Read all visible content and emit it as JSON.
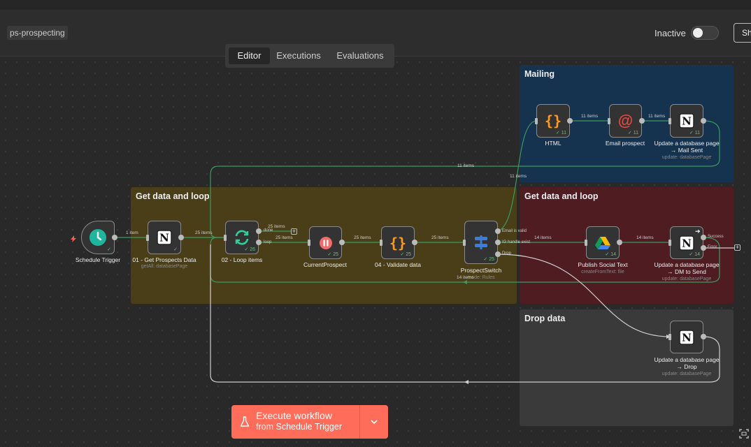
{
  "header": {
    "workflow_name": "ps-prospecting",
    "status_label": "Inactive",
    "share_label": "Sh"
  },
  "tabs": [
    {
      "label": "Editor",
      "active": true
    },
    {
      "label": "Executions",
      "active": false
    },
    {
      "label": "Evaluations",
      "active": false
    }
  ],
  "stickies": {
    "mailing": {
      "title": "Mailing",
      "color": "#15324f"
    },
    "get_data_loop": {
      "title": "Get data and loop",
      "color": "#4a3e18"
    },
    "get_data_loop_2": {
      "title": "Get data and loop",
      "color": "#4e1c21"
    },
    "drop_data": {
      "title": "Drop data",
      "color": "#3a3a3a"
    }
  },
  "nodes": {
    "schedule": {
      "label": "Schedule Trigger",
      "icon": "clock-icon"
    },
    "get_prospects": {
      "label": "01 - Get Prospects Data",
      "sub": "getAll: databasePage",
      "icon": "notion-icon"
    },
    "loop": {
      "label": "02 - Loop items",
      "count": "26",
      "icon": "loop-icon"
    },
    "current_prospect": {
      "label": "CurrentProspect",
      "count": "25",
      "icon": "pause-icon"
    },
    "validate": {
      "label": "04 - Validate data",
      "count": "25",
      "icon": "code-braces-icon"
    },
    "prospect_switch": {
      "label": "ProspectSwitch",
      "sub": "mode: Rules",
      "count": "25",
      "icon": "switch-icon"
    },
    "html": {
      "label": "HTML",
      "count": "11",
      "icon": "code-braces-icon"
    },
    "email": {
      "label": "Email prospect",
      "count": "11",
      "icon": "at-icon"
    },
    "update_mail": {
      "label1": "Update a database page",
      "label2": "→ Mail Sent",
      "sub": "update: databasePage",
      "count": "11",
      "icon": "notion-icon"
    },
    "publish": {
      "label": "Publish Social Text",
      "sub": "createFromText: file",
      "count": "14",
      "icon": "drive-icon"
    },
    "update_dm": {
      "label1": "Update a database page",
      "label2": "→ DM to Send",
      "sub": "update: databasePage",
      "count": "14",
      "icon": "notion-icon"
    },
    "update_drop": {
      "label1": "Update a database page",
      "label2": "→ Drop",
      "sub": "update: databasePage",
      "icon": "notion-icon"
    }
  },
  "edges": {
    "e1": "1 item",
    "e2": "25 items",
    "e_done": "25 items",
    "e_loop": "25 items",
    "e3": "25 items",
    "e4": "25 items",
    "e_11top": "11 items",
    "e_11right": "11 items",
    "e_html_email": "11 items",
    "e_email_update": "11 items",
    "e_ig": "14 items",
    "e_publish": "14 items",
    "e_14back": "14 items"
  },
  "outputs": {
    "done": "done",
    "loop": "loop",
    "email_valid": "Email is valid",
    "ig_handle": "IG handle exist",
    "drop": "Drop",
    "success": "Success",
    "error": "Error"
  },
  "execute": {
    "title": "Execute workflow",
    "from_label": "from",
    "from_node": "Schedule Trigger"
  },
  "colors": {
    "accent": "#ff6d5a",
    "success": "#6bbf7a",
    "wire_active": "#3a9a62"
  }
}
